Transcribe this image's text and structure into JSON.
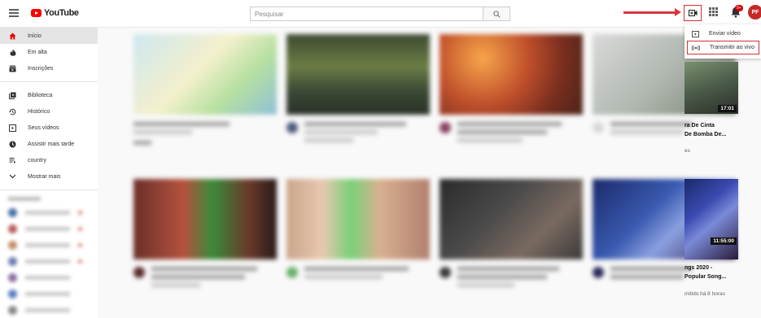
{
  "header": {
    "logo_text": "YouTube",
    "search_placeholder": "Pesquisar",
    "notifications_badge": "9+",
    "avatar_initials": "PF"
  },
  "sidebar": {
    "items": [
      {
        "label": "Início",
        "icon": "home-icon",
        "active": true
      },
      {
        "label": "Em alta",
        "icon": "fire-icon"
      },
      {
        "label": "Inscrições",
        "icon": "subscriptions-icon"
      },
      {
        "label": "Biblioteca",
        "icon": "library-icon"
      },
      {
        "label": "Histórico",
        "icon": "history-icon"
      },
      {
        "label": "Seus vídeos",
        "icon": "play-square-icon"
      },
      {
        "label": "Assistir mais tarde",
        "icon": "clock-icon"
      },
      {
        "label": "country",
        "icon": "playlist-icon"
      },
      {
        "label": "Mostrar mais",
        "icon": "chevron-down-icon"
      }
    ]
  },
  "create_menu": {
    "items": [
      {
        "label": "Enviar vídeo",
        "icon": "upload-video-icon"
      },
      {
        "label": "Transmitir ao vivo",
        "icon": "live-broadcast-icon"
      }
    ]
  },
  "visible_video_fragments": {
    "row1_duration": "17:01",
    "row1_title_line1": "ra De Cinta",
    "row1_title_line2": "De Bomba De...",
    "row1_meta": "es",
    "row2_duration": "11:55:00",
    "row2_title_line1": "ngs 2020 -",
    "row2_title_line2": "Popular Song...",
    "row2_meta": "mitido há 8 horas"
  },
  "colors": {
    "accent_red": "#ff0000",
    "annotation_red": "#d9363e"
  }
}
